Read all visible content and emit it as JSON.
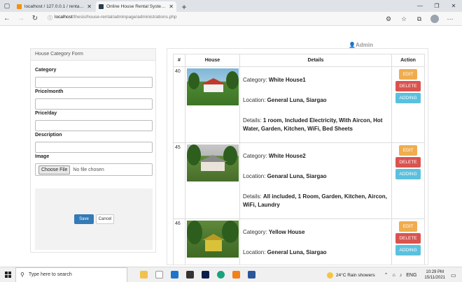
{
  "browser": {
    "tabs": [
      {
        "title": "localhost / 127.0.0.1 / rental / ch",
        "active": false,
        "favicon_color": "#f29111"
      },
      {
        "title": "Online House Rental System for",
        "active": true,
        "favicon_color": "#2c3e50"
      }
    ],
    "url_host": "localhost",
    "url_path": "/thesis/house-rental/adminpage/administrations.php"
  },
  "page": {
    "admin_label": "Admin",
    "form": {
      "heading": "House Category Form",
      "category_label": "Category",
      "price_month_label": "Price/month",
      "price_day_label": "Price/day",
      "description_label": "Description",
      "image_label": "Image",
      "file_button": "Choose File",
      "file_status": "No file chosen",
      "save_label": "Save",
      "cancel_label": "Cancel"
    },
    "table": {
      "headers": {
        "num": "#",
        "house": "House",
        "details": "Details",
        "action": "Action"
      },
      "rows": [
        {
          "id": "40",
          "category_prefix": "Category: ",
          "category": "White House1",
          "location_prefix": "Location: ",
          "location": "General Luna, Siargao",
          "details_prefix": "Details: ",
          "details": "1 room, Included Electricity, With Aircon, Hot Water, Garden, Kitchen, WiFi, Bed Sheets"
        },
        {
          "id": "45",
          "category_prefix": "Category: ",
          "category": "White House2",
          "location_prefix": "Location: ",
          "location": "Genaral Luna, Siargao",
          "details_prefix": "Details: ",
          "details": "All included, 1 Room, Garden, Kitchen, Aircon, WiFi, Laundry"
        },
        {
          "id": "46",
          "category_prefix": "Category: ",
          "category": "Yellow House",
          "location_prefix": "Location: ",
          "location": "General Luna, Siargao",
          "details_prefix": "",
          "details": ""
        }
      ],
      "actions": {
        "edit": "EDIT",
        "delete": "DELETE",
        "adding": "ADDING"
      }
    }
  },
  "taskbar": {
    "search_placeholder": "Type here to search",
    "weather": "24°C  Rain showers",
    "language": "ENG",
    "time": "10:29 PM",
    "date": "15/11/2021"
  }
}
